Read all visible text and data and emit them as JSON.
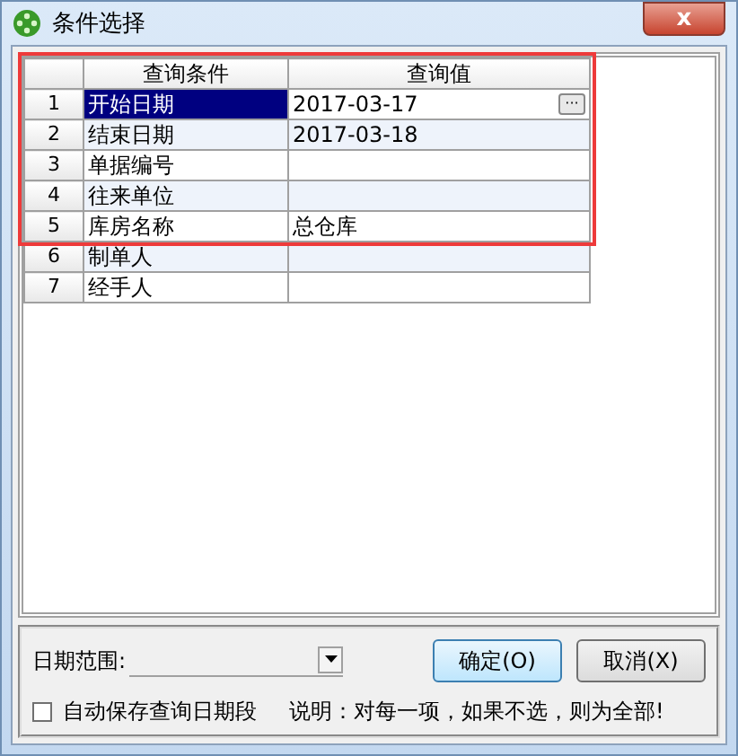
{
  "window": {
    "title": "条件选择",
    "close": "x"
  },
  "grid": {
    "columns": [
      "查询条件",
      "查询值"
    ],
    "rows": [
      {
        "number": "1",
        "condition": "开始日期",
        "value": "2017-03-17",
        "selected": true,
        "picker": "···"
      },
      {
        "number": "2",
        "condition": "结束日期",
        "value": "2017-03-18",
        "selected": false
      },
      {
        "number": "3",
        "condition": "单据编号",
        "value": "",
        "selected": false
      },
      {
        "number": "4",
        "condition": "往来单位",
        "value": "",
        "selected": false
      },
      {
        "number": "5",
        "condition": "库房名称",
        "value": "总仓库",
        "selected": false
      },
      {
        "number": "6",
        "condition": "制单人",
        "value": "",
        "selected": false
      },
      {
        "number": "7",
        "condition": "经手人",
        "value": "",
        "selected": false
      }
    ]
  },
  "date_range": {
    "label": "日期范围:"
  },
  "buttons": [
    "确定(O)",
    "取消(X)"
  ],
  "auto_save": {
    "label": "自动保存查询日期段",
    "checked": false
  },
  "note": "说明：对每一项，如果不选，则为全部!"
}
